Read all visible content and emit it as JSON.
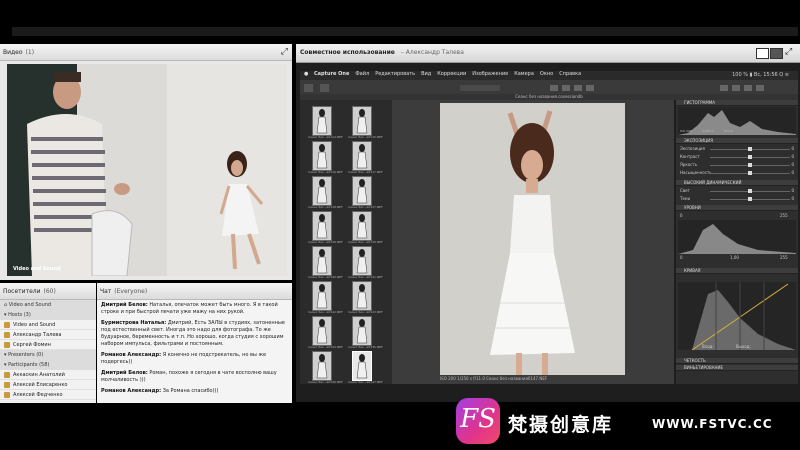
{
  "video": {
    "title": "Видео",
    "count": "(1)",
    "overlay_label": "Video and Sound"
  },
  "attendees": {
    "title": "Посетители",
    "count": "(60)",
    "groups": [
      {
        "label": "Video and Sound",
        "type": "top"
      },
      {
        "label": "Hosts (3)",
        "type": "group"
      },
      {
        "label": "Video and Sound",
        "type": "person"
      },
      {
        "label": "Александр Талева",
        "type": "person"
      },
      {
        "label": "Сергей Фомин",
        "type": "person"
      },
      {
        "label": "Presenters (0)",
        "type": "group"
      },
      {
        "label": "Participants (58)",
        "type": "group"
      },
      {
        "label": "Аккаскин Анатолий",
        "type": "person"
      },
      {
        "label": "Алексей Елисаренко",
        "type": "person"
      },
      {
        "label": "Алексей Федченко",
        "type": "person"
      }
    ]
  },
  "chat": {
    "title": "Чат",
    "scope": "(Everyone)",
    "messages": [
      {
        "author": "Дмитрий Белов:",
        "text": "Наталья, опечаток может быть много. Я в такой строке и при быстрой печати уже мажу на них рукой."
      },
      {
        "author": "Бурмистрова Наталья:",
        "text": "Дмитрий, Есть ЗАЛЫ в студиях, затоненные под естественный свет. Иногда это надо для фотографа. То же будуарное, беременность и т.п. Но хорошо, когда студия с хорошим набором импульса, фильтрами и постоянным."
      },
      {
        "author": "Романов Александр:",
        "text": "Я конечно не подстрекатель, но вы же подергесь))"
      },
      {
        "author": "Дмитрий Белов:",
        "text": "Роман, похоже я сегодня в чате восполню вашу молчаливость )))"
      },
      {
        "author": "Романов Александр:",
        "text": "За Романа спасибо)))"
      }
    ]
  },
  "share": {
    "title": "Совместное использование",
    "presenter": "– Александр Талева"
  },
  "capture_one": {
    "menu": [
      "Capture One",
      "Файл",
      "Редактировать",
      "Вид",
      "Коррекции",
      "Изображение",
      "Камера",
      "Окно",
      "Справка"
    ],
    "status_right": "100 % ▮  Вс, 15:56  Q  ≡",
    "session_title": "Сеанс без названия.cosessiondb",
    "viewer_footer": "ISO 200   1/250 s   f/11.0          Сеанс без названия0147.NEF",
    "thumb_captions": [
      "Сеанс без...a0114.NEF",
      "Сеанс без...a0115.NEF",
      "Сеанс без...a0116.NEF",
      "Сеанс без...a0117.NEF",
      "Сеанс без...a0118.NEF",
      "Сеанс без...a0137.NEF",
      "Сеанс без...a0138.NEF",
      "Сеанс без...a0139.NEF",
      "Сеанс без...a0140.NEF",
      "Сеанс без...a0141.NEF",
      "Сеанс без...a0142.NEF",
      "Сеанс без...a0143.NEF",
      "Сеанс без...a0144.NEF",
      "Сеанс без...a0145.NEF",
      "Сеанс без...a0146.NEF",
      "Сеанс без...a0147.NEF"
    ],
    "tools": {
      "histogram": "ГИСТОГРАММА",
      "histogram_readout": "ISO 200           1/250 s           f/11.0",
      "exposure": "ЭКСПОЗИЦИЯ",
      "exposure_sliders": [
        {
          "label": "Экспозиция",
          "value": "0"
        },
        {
          "label": "Контраст",
          "value": "0"
        },
        {
          "label": "Яркость",
          "value": "0"
        },
        {
          "label": "Насыщенность",
          "value": "0"
        }
      ],
      "hdr": "ВЫСОКИЙ ДИНАМИЧЕСКИЙ",
      "hdr_sliders": [
        {
          "label": "Свет",
          "value": "0"
        },
        {
          "label": "Тени",
          "value": "0"
        }
      ],
      "levels": "УРОВНИ",
      "levels_values": [
        "0",
        "255",
        "0",
        "1,00",
        "255"
      ],
      "curve": "КРИВАЯ",
      "curve_readout": [
        "Вход:",
        "Выход:"
      ],
      "sharpness": "ЧЕТКОСТЬ",
      "vignetting": "ВИНЬЕТИРОВАНИЕ"
    }
  },
  "brand": {
    "logo_text": "FS",
    "chinese_name": "梵摄创意库",
    "url": "WWW.FSTVC.CC"
  },
  "colors": {
    "badge_start": "#a43ee6",
    "badge_end": "#f04a6a",
    "host_badge": "#c99a3b"
  }
}
